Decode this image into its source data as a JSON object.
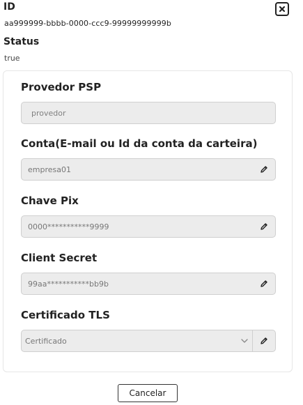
{
  "header": {
    "id_label": "ID",
    "id_value": "aa999999-bbbb-0000-ccc9-99999999999b",
    "status_label": "Status",
    "status_value": "true",
    "close_icon": "close-icon"
  },
  "form": {
    "fields": [
      {
        "label": "Provedor PSP",
        "value": "provedor",
        "editable": false
      },
      {
        "label": "Conta(E-mail ou Id da conta da carteira)",
        "value": "empresa01",
        "editable": true
      },
      {
        "label": "Chave Pix",
        "value": "0000***********9999",
        "editable": true
      },
      {
        "label": "Client Secret",
        "value": "99aa***********bb9b",
        "editable": true
      },
      {
        "label": "Certificado TLS",
        "value": "Certificado",
        "type": "select",
        "editable": true
      }
    ],
    "edit_icon": "pencil-icon",
    "select_icon": "chevron-down-icon"
  },
  "footer": {
    "cancel_label": "Cancelar"
  }
}
